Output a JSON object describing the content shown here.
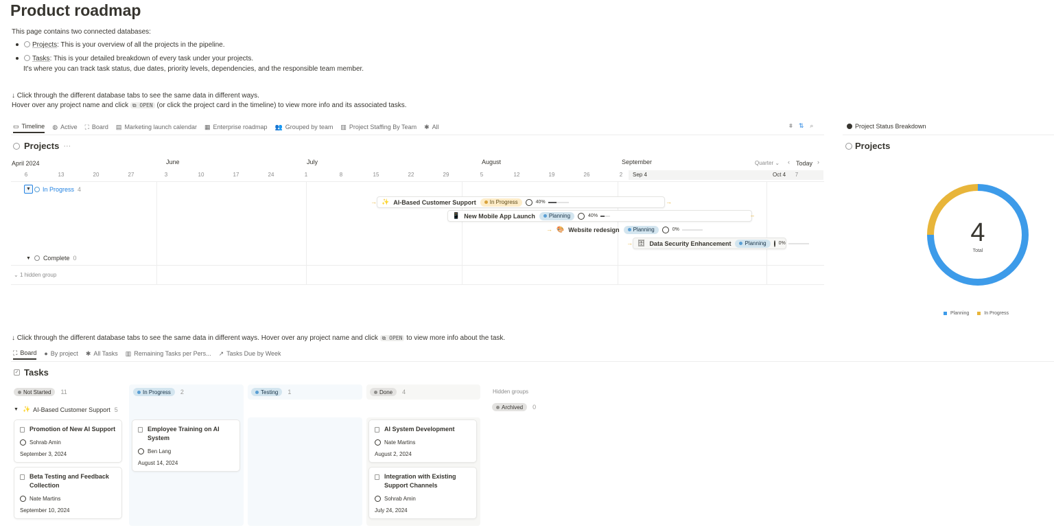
{
  "page": {
    "title": "Product roadmap",
    "intro": "This page contains two connected databases:",
    "bullets": [
      {
        "name": "Projects",
        "text": ": This is your overview of all the projects in the pipeline."
      },
      {
        "name": "Tasks",
        "text": ": This is your detailed breakdown of every task under your projects.",
        "text2": "It's where you can track task status, due dates, priority levels, dependencies, and the responsible team member."
      }
    ],
    "hint1": "↓ Click through the different database tabs to see the same data in different ways.",
    "hint2_pre": "Hover over any project name and click",
    "hint2_code": "⧉ OPEN",
    "hint2_post": "(or click the project card in the timeline) to view more info and its associated tasks.",
    "hint3_pre": "↓ Click through the different database tabs to see the same data in different ways. Hover over any project name and click",
    "hint3_code": "⧉ OPEN",
    "hint3_post": "to view more info about the task."
  },
  "projects_view": {
    "tabs": [
      {
        "label": "Timeline",
        "icon": "timeline-icon",
        "glyph": "▭",
        "active": true
      },
      {
        "label": "Active",
        "icon": "active-icon",
        "glyph": "◍",
        "active": false
      },
      {
        "label": "Board",
        "icon": "board-icon",
        "glyph": "⛶",
        "active": false
      },
      {
        "label": "Marketing launch calendar",
        "icon": "calendar-icon",
        "glyph": "▤",
        "active": false
      },
      {
        "label": "Enterprise roadmap",
        "icon": "table-icon",
        "glyph": "▦",
        "active": false
      },
      {
        "label": "Grouped by team",
        "icon": "people-icon",
        "glyph": "👥",
        "active": false
      },
      {
        "label": "Project Staffing By Team",
        "icon": "chart-icon",
        "glyph": "▥",
        "active": false
      },
      {
        "label": "All",
        "icon": "asterisk-icon",
        "glyph": "✱",
        "active": false
      }
    ],
    "db_title": "Projects",
    "db_more": "···",
    "month_label": "April 2024",
    "months": [
      "June",
      "July",
      "August",
      "September"
    ],
    "days": [
      "6",
      "13",
      "20",
      "27",
      "3",
      "10",
      "17",
      "24",
      "1",
      "8",
      "15",
      "22",
      "29",
      "5",
      "12",
      "19",
      "26",
      "2",
      "7"
    ],
    "range_start": "Sep 4",
    "range_end": "Oct 4",
    "zoom": "Quarter ⌄",
    "today": "Today",
    "groups": {
      "in_progress": {
        "label": "In Progress",
        "count": "4"
      },
      "complete": {
        "label": "Complete",
        "count": "0"
      },
      "hidden": "1 hidden group"
    },
    "items": [
      {
        "name": "AI-Based Customer Support",
        "emoji": "✨",
        "status": "In Progress",
        "progress": "40%",
        "progress_value": 0.4
      },
      {
        "name": "New Mobile App Launch",
        "emoji": "📱",
        "status": "Planning",
        "progress": "40%",
        "progress_value": 0.4
      },
      {
        "name": "Website redesign",
        "emoji": "🎨",
        "status": "Planning",
        "progress": "0%",
        "progress_value": 0
      },
      {
        "name": "Data Security Enhancement",
        "emoji": "🗄",
        "status": "Planning",
        "progress": "0%",
        "progress_value": 0
      }
    ]
  },
  "status_panel": {
    "tab": "Project Status Breakdown",
    "title": "Projects",
    "total": "4",
    "total_label": "Total"
  },
  "chart_data": {
    "type": "pie",
    "title": "",
    "categories": [
      "Planning",
      "In Progress"
    ],
    "values": [
      3,
      1
    ],
    "colors": [
      "#3d9be9",
      "#e8b53a"
    ],
    "legend": "bottom"
  },
  "tasks_view": {
    "tabs": [
      {
        "label": "Board",
        "icon": "board-icon",
        "glyph": "⛶",
        "active": true
      },
      {
        "label": "By project",
        "icon": "project-icon",
        "glyph": "●",
        "active": false
      },
      {
        "label": "All Tasks",
        "icon": "asterisk-icon",
        "glyph": "✱",
        "active": false
      },
      {
        "label": "Remaining Tasks per Pers...",
        "icon": "chart-icon",
        "glyph": "▥",
        "active": false
      },
      {
        "label": "Tasks Due by Week",
        "icon": "line-chart-icon",
        "glyph": "↗",
        "active": false
      }
    ],
    "db_title": "Tasks",
    "columns": [
      {
        "label": "Not Started",
        "count": "11",
        "style": "p-ns"
      },
      {
        "label": "In Progress",
        "count": "2",
        "style": "p-plan"
      },
      {
        "label": "Testing",
        "count": "1",
        "style": "p-test"
      },
      {
        "label": "Done",
        "count": "4",
        "style": "p-done"
      }
    ],
    "hidden_groups_label": "Hidden groups",
    "archived": {
      "label": "Archived",
      "count": "0"
    },
    "group": {
      "label": "AI-Based Customer Support",
      "count": "5"
    },
    "cards": {
      "not_started": [
        {
          "title": "Promotion of New AI Support",
          "person": "Sohrab Amin",
          "date": "September 3, 2024"
        },
        {
          "title": "Beta Testing and Feedback Collection",
          "person": "Nate Martins",
          "date": "September 10, 2024"
        }
      ],
      "in_progress": [
        {
          "title": "Employee Training on AI System",
          "person": "Ben Lang",
          "date": "August 14, 2024"
        }
      ],
      "done": [
        {
          "title": "AI System Development",
          "person": "Nate Martins",
          "date": "August 2, 2024"
        },
        {
          "title": "Integration with Existing Support Channels",
          "person": "Sohrab Amin",
          "date": "July 24, 2024"
        }
      ]
    }
  }
}
